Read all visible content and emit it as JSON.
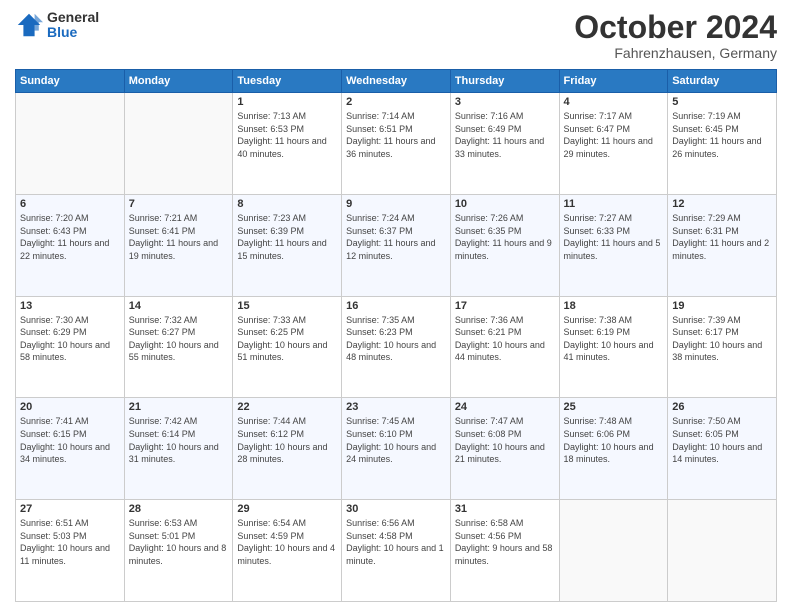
{
  "header": {
    "logo_general": "General",
    "logo_blue": "Blue",
    "month_title": "October 2024",
    "location": "Fahrenzhausen, Germany"
  },
  "days_of_week": [
    "Sunday",
    "Monday",
    "Tuesday",
    "Wednesday",
    "Thursday",
    "Friday",
    "Saturday"
  ],
  "weeks": [
    [
      {
        "day": "",
        "sunrise": "",
        "sunset": "",
        "daylight": ""
      },
      {
        "day": "",
        "sunrise": "",
        "sunset": "",
        "daylight": ""
      },
      {
        "day": "1",
        "sunrise": "Sunrise: 7:13 AM",
        "sunset": "Sunset: 6:53 PM",
        "daylight": "Daylight: 11 hours and 40 minutes."
      },
      {
        "day": "2",
        "sunrise": "Sunrise: 7:14 AM",
        "sunset": "Sunset: 6:51 PM",
        "daylight": "Daylight: 11 hours and 36 minutes."
      },
      {
        "day": "3",
        "sunrise": "Sunrise: 7:16 AM",
        "sunset": "Sunset: 6:49 PM",
        "daylight": "Daylight: 11 hours and 33 minutes."
      },
      {
        "day": "4",
        "sunrise": "Sunrise: 7:17 AM",
        "sunset": "Sunset: 6:47 PM",
        "daylight": "Daylight: 11 hours and 29 minutes."
      },
      {
        "day": "5",
        "sunrise": "Sunrise: 7:19 AM",
        "sunset": "Sunset: 6:45 PM",
        "daylight": "Daylight: 11 hours and 26 minutes."
      }
    ],
    [
      {
        "day": "6",
        "sunrise": "Sunrise: 7:20 AM",
        "sunset": "Sunset: 6:43 PM",
        "daylight": "Daylight: 11 hours and 22 minutes."
      },
      {
        "day": "7",
        "sunrise": "Sunrise: 7:21 AM",
        "sunset": "Sunset: 6:41 PM",
        "daylight": "Daylight: 11 hours and 19 minutes."
      },
      {
        "day": "8",
        "sunrise": "Sunrise: 7:23 AM",
        "sunset": "Sunset: 6:39 PM",
        "daylight": "Daylight: 11 hours and 15 minutes."
      },
      {
        "day": "9",
        "sunrise": "Sunrise: 7:24 AM",
        "sunset": "Sunset: 6:37 PM",
        "daylight": "Daylight: 11 hours and 12 minutes."
      },
      {
        "day": "10",
        "sunrise": "Sunrise: 7:26 AM",
        "sunset": "Sunset: 6:35 PM",
        "daylight": "Daylight: 11 hours and 9 minutes."
      },
      {
        "day": "11",
        "sunrise": "Sunrise: 7:27 AM",
        "sunset": "Sunset: 6:33 PM",
        "daylight": "Daylight: 11 hours and 5 minutes."
      },
      {
        "day": "12",
        "sunrise": "Sunrise: 7:29 AM",
        "sunset": "Sunset: 6:31 PM",
        "daylight": "Daylight: 11 hours and 2 minutes."
      }
    ],
    [
      {
        "day": "13",
        "sunrise": "Sunrise: 7:30 AM",
        "sunset": "Sunset: 6:29 PM",
        "daylight": "Daylight: 10 hours and 58 minutes."
      },
      {
        "day": "14",
        "sunrise": "Sunrise: 7:32 AM",
        "sunset": "Sunset: 6:27 PM",
        "daylight": "Daylight: 10 hours and 55 minutes."
      },
      {
        "day": "15",
        "sunrise": "Sunrise: 7:33 AM",
        "sunset": "Sunset: 6:25 PM",
        "daylight": "Daylight: 10 hours and 51 minutes."
      },
      {
        "day": "16",
        "sunrise": "Sunrise: 7:35 AM",
        "sunset": "Sunset: 6:23 PM",
        "daylight": "Daylight: 10 hours and 48 minutes."
      },
      {
        "day": "17",
        "sunrise": "Sunrise: 7:36 AM",
        "sunset": "Sunset: 6:21 PM",
        "daylight": "Daylight: 10 hours and 44 minutes."
      },
      {
        "day": "18",
        "sunrise": "Sunrise: 7:38 AM",
        "sunset": "Sunset: 6:19 PM",
        "daylight": "Daylight: 10 hours and 41 minutes."
      },
      {
        "day": "19",
        "sunrise": "Sunrise: 7:39 AM",
        "sunset": "Sunset: 6:17 PM",
        "daylight": "Daylight: 10 hours and 38 minutes."
      }
    ],
    [
      {
        "day": "20",
        "sunrise": "Sunrise: 7:41 AM",
        "sunset": "Sunset: 6:15 PM",
        "daylight": "Daylight: 10 hours and 34 minutes."
      },
      {
        "day": "21",
        "sunrise": "Sunrise: 7:42 AM",
        "sunset": "Sunset: 6:14 PM",
        "daylight": "Daylight: 10 hours and 31 minutes."
      },
      {
        "day": "22",
        "sunrise": "Sunrise: 7:44 AM",
        "sunset": "Sunset: 6:12 PM",
        "daylight": "Daylight: 10 hours and 28 minutes."
      },
      {
        "day": "23",
        "sunrise": "Sunrise: 7:45 AM",
        "sunset": "Sunset: 6:10 PM",
        "daylight": "Daylight: 10 hours and 24 minutes."
      },
      {
        "day": "24",
        "sunrise": "Sunrise: 7:47 AM",
        "sunset": "Sunset: 6:08 PM",
        "daylight": "Daylight: 10 hours and 21 minutes."
      },
      {
        "day": "25",
        "sunrise": "Sunrise: 7:48 AM",
        "sunset": "Sunset: 6:06 PM",
        "daylight": "Daylight: 10 hours and 18 minutes."
      },
      {
        "day": "26",
        "sunrise": "Sunrise: 7:50 AM",
        "sunset": "Sunset: 6:05 PM",
        "daylight": "Daylight: 10 hours and 14 minutes."
      }
    ],
    [
      {
        "day": "27",
        "sunrise": "Sunrise: 6:51 AM",
        "sunset": "Sunset: 5:03 PM",
        "daylight": "Daylight: 10 hours and 11 minutes."
      },
      {
        "day": "28",
        "sunrise": "Sunrise: 6:53 AM",
        "sunset": "Sunset: 5:01 PM",
        "daylight": "Daylight: 10 hours and 8 minutes."
      },
      {
        "day": "29",
        "sunrise": "Sunrise: 6:54 AM",
        "sunset": "Sunset: 4:59 PM",
        "daylight": "Daylight: 10 hours and 4 minutes."
      },
      {
        "day": "30",
        "sunrise": "Sunrise: 6:56 AM",
        "sunset": "Sunset: 4:58 PM",
        "daylight": "Daylight: 10 hours and 1 minute."
      },
      {
        "day": "31",
        "sunrise": "Sunrise: 6:58 AM",
        "sunset": "Sunset: 4:56 PM",
        "daylight": "Daylight: 9 hours and 58 minutes."
      },
      {
        "day": "",
        "sunrise": "",
        "sunset": "",
        "daylight": ""
      },
      {
        "day": "",
        "sunrise": "",
        "sunset": "",
        "daylight": ""
      }
    ]
  ]
}
